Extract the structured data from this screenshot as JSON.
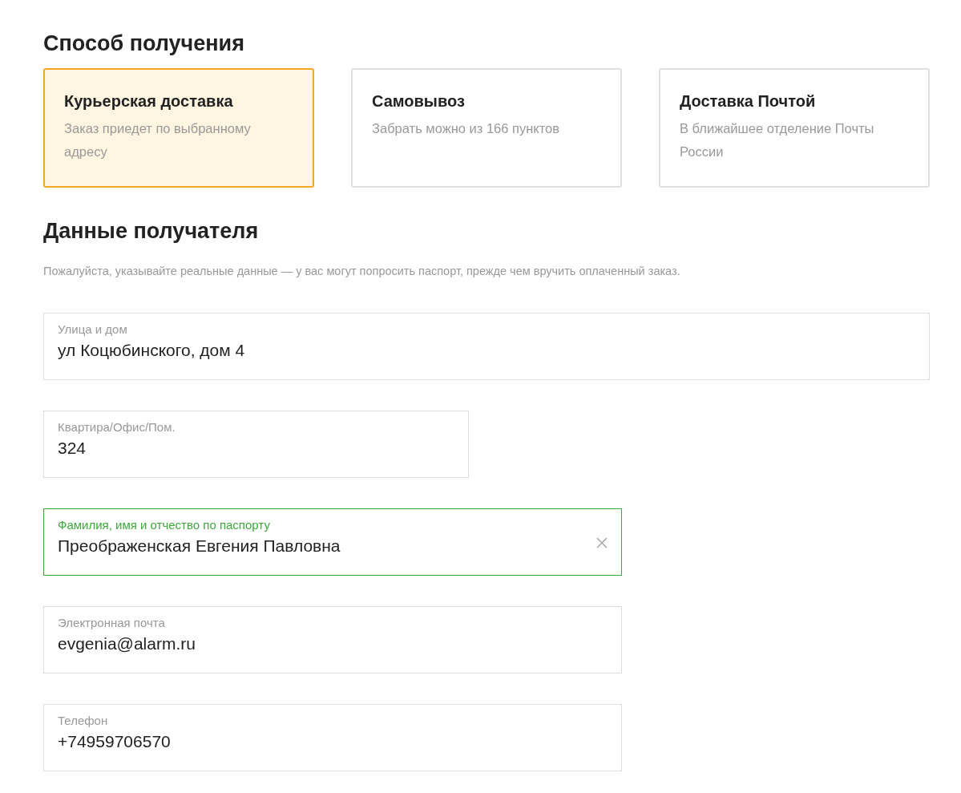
{
  "delivery": {
    "title": "Способ получения",
    "options": [
      {
        "title": "Курьерская доставка",
        "description": "Заказ приедет по выбранному адресу",
        "selected": true
      },
      {
        "title": "Самовывоз",
        "description": "Забрать можно из 166 пунктов",
        "selected": false
      },
      {
        "title": "Доставка Почтой",
        "description": "В ближайшее отделение Почты России",
        "selected": false
      }
    ]
  },
  "recipient": {
    "title": "Данные получателя",
    "note": "Пожалуйста, указывайте реальные данные — у вас могут попросить паспорт, прежде чем вручить оплаченный заказ.",
    "fields": [
      {
        "label": "Улица и дом",
        "value": "ул Коцюбинского, дом 4",
        "kind": "full",
        "focused": false
      },
      {
        "label": "Квартира/Офис/Пом.",
        "value": "324",
        "kind": "short",
        "focused": false
      },
      {
        "label": "Фамилия, имя и отчество по паспорту",
        "value": "Преображенская Евгения Павловна",
        "kind": "medium",
        "focused": true
      },
      {
        "label": "Электронная почта",
        "value": "evgenia@alarm.ru",
        "kind": "medium",
        "focused": false
      },
      {
        "label": "Телефон",
        "value": "+74959706570",
        "kind": "medium",
        "focused": false
      }
    ]
  }
}
